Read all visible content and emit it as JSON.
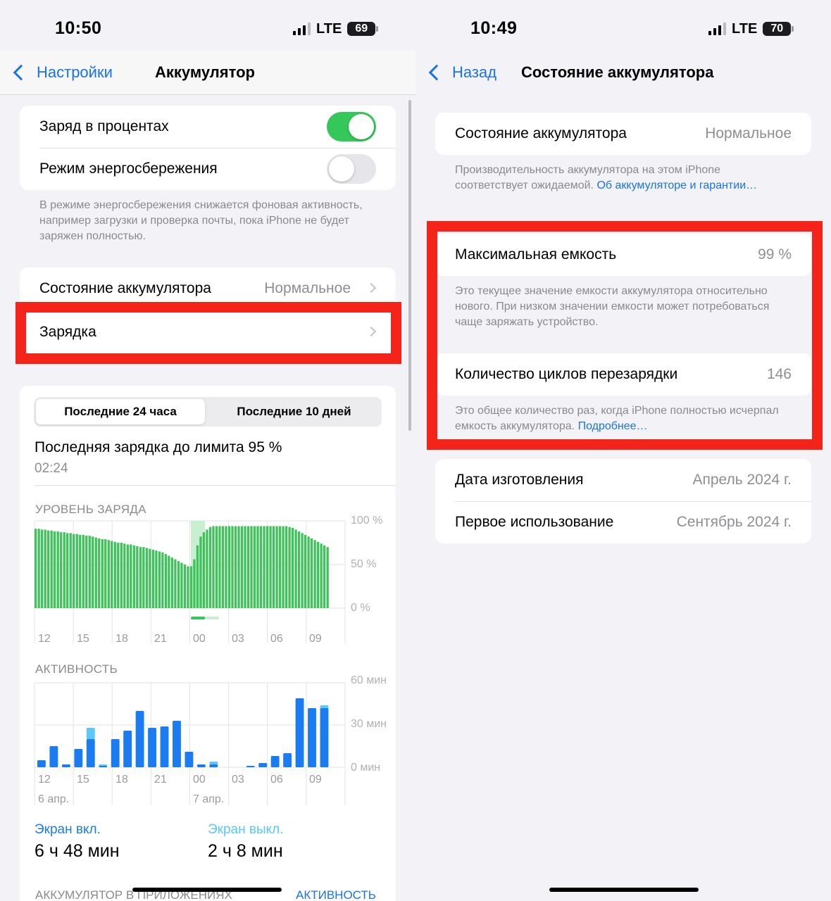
{
  "left": {
    "status": {
      "time": "10:50",
      "network": "LTE",
      "battery": "69"
    },
    "nav": {
      "back_label": "Настройки",
      "title": "Аккумулятор"
    },
    "toggles": [
      {
        "label": "Заряд в процентах",
        "on": true
      },
      {
        "label": "Режим энергосбережения",
        "on": false
      }
    ],
    "power_note": "В режиме энергосбережения снижается фоновая активность, например загрузки и проверка почты, пока iPhone не будет заряжен полностью.",
    "health_row": {
      "label": "Состояние аккумулятора",
      "value": "Нормальное"
    },
    "charging_row": {
      "label": "Зарядка"
    },
    "segment": {
      "tab_24h": "Последние 24 часа",
      "tab_10d": "Последние 10 дней",
      "selected": "tab_24h"
    },
    "last_charge": {
      "title": "Последняя зарядка до лимита 95 %",
      "time": "02:24"
    },
    "accent_colors": {
      "battery_green": "#3ec35a",
      "activity_blue": "#1a7cf0",
      "activity_light": "#5ac8fa",
      "link_blue": "#1a73e8",
      "highlight_red": "#f5241a"
    },
    "battery_chart": {
      "title": "УРОВЕНЬ ЗАРЯДА",
      "type": "bar",
      "y_labels": [
        "100 %",
        "50 %",
        "0 %"
      ],
      "ylim": [
        0,
        100
      ],
      "x_ticks": [
        "12",
        "15",
        "18",
        "21",
        "00",
        "03",
        "06",
        "09"
      ],
      "values": [
        91,
        91,
        90,
        90,
        89,
        89,
        88,
        88,
        87,
        87,
        86,
        86,
        85,
        85,
        84,
        84,
        83,
        83,
        82,
        81,
        80,
        79,
        79,
        78,
        77,
        76,
        75,
        75,
        74,
        73,
        73,
        72,
        71,
        70,
        70,
        69,
        68,
        67,
        66,
        65,
        64,
        62,
        60,
        58,
        56,
        54,
        52,
        50,
        48,
        48,
        56,
        72,
        82,
        87,
        90,
        93,
        94,
        94,
        94,
        94,
        94,
        94,
        94,
        94,
        94,
        94,
        94,
        94,
        94,
        94,
        94,
        94,
        94,
        94,
        94,
        94,
        94,
        94,
        94,
        94,
        93,
        92,
        90,
        88,
        86,
        84,
        82,
        80,
        78,
        76,
        74,
        72,
        70
      ]
    },
    "activity_chart": {
      "title": "АКТИВНОСТЬ",
      "type": "bar",
      "y_labels": [
        "60 мин",
        "30 мин",
        "0 мин"
      ],
      "ylim": [
        0,
        60
      ],
      "x_ticks": [
        "12",
        "15",
        "18",
        "21",
        "00",
        "03",
        "06",
        "09"
      ],
      "date_labels": [
        "6 апр.",
        "7 апр."
      ],
      "series": [
        {
          "name": "Экран вкл.",
          "values": [
            5,
            15,
            2,
            13,
            20,
            1,
            20,
            26,
            40,
            28,
            29,
            33,
            11,
            2,
            2,
            0,
            0,
            1,
            3,
            8,
            10,
            49,
            42,
            42
          ]
        },
        {
          "name": "Экран выкл.",
          "values": [
            0,
            0,
            0,
            0,
            8,
            1,
            0,
            0,
            0,
            0,
            0,
            0,
            0,
            0,
            2,
            0,
            0,
            0,
            0,
            0,
            0,
            0,
            0,
            2
          ]
        }
      ]
    },
    "usage": [
      {
        "label": "Экран вкл.",
        "value": "6 ч 48 мин"
      },
      {
        "label": "Экран выкл.",
        "value": "2 ч 8 мин"
      }
    ],
    "bottom": {
      "section_label": "АККУМУЛЯТОР В ПРИЛОЖЕНИЯХ",
      "action": "АКТИВНОСТЬ"
    }
  },
  "right": {
    "status": {
      "time": "10:49",
      "network": "LTE",
      "battery": "70"
    },
    "nav": {
      "back_label": "Назад",
      "title": "Состояние аккумулятора"
    },
    "health_row": {
      "label": "Состояние аккумулятора",
      "value": "Нормальное"
    },
    "health_note": {
      "text": "Производительность аккумулятора на этом iPhone соответствует ожидаемой.",
      "link": "Об аккумуляторе и гарантии…"
    },
    "max_capacity": {
      "label": "Максимальная емкость",
      "value": "99 %"
    },
    "capacity_note": "Это текущее значение емкости аккумулятора относительно нового. При низком значении емкости может потребоваться чаще заряжать устройство.",
    "cycles": {
      "label": "Количество циклов перезарядки",
      "value": "146"
    },
    "cycles_note": {
      "text": "Это общее количество раз, когда iPhone полностью исчерпал емкость аккумулятора.",
      "link": "Подробнее…"
    },
    "manufacture": {
      "label": "Дата изготовления",
      "value": "Апрель 2024 г."
    },
    "first_use": {
      "label": "Первое использование",
      "value": "Сентябрь 2024 г."
    }
  }
}
